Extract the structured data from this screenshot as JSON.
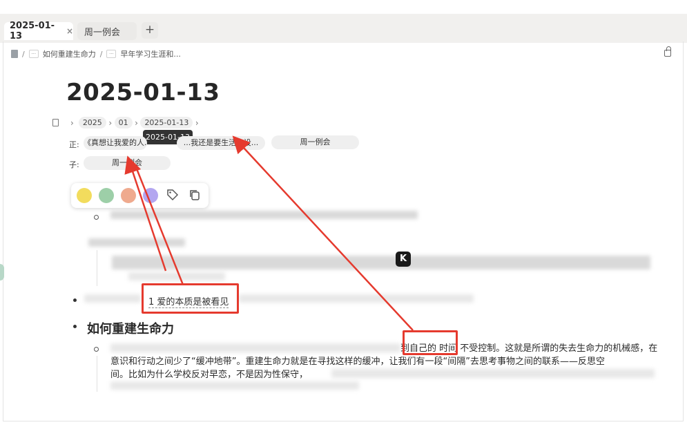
{
  "tabs": [
    {
      "label": "2025-01-13",
      "close": "×",
      "active": true
    },
    {
      "label": "周一例会",
      "active": false
    }
  ],
  "tab_add": "+",
  "breadcrumb": {
    "sep": "/",
    "items": [
      "如何重建生命力",
      "早年学习生涯和..."
    ]
  },
  "page": {
    "title": "2025-01-13",
    "path": [
      "2025",
      "01",
      "2025-01-13"
    ],
    "tooltip": "2025-01-13"
  },
  "relations": {
    "forward_label": "正:",
    "forward_items": [
      "《真想让我爱的人...",
      "...我还是要生活...设...",
      "周一例会"
    ],
    "child_label": "子:",
    "child_items": [
      "周一例会"
    ]
  },
  "toolbar": {
    "colors": [
      "#f2dc5d",
      "#9dcfa8",
      "#efaa8e",
      "#b3a6f0"
    ],
    "icons": [
      "tag-icon",
      "copy-icon"
    ]
  },
  "content": {
    "highlight_text": "1 爱的本质是被看见",
    "heading": "如何重建生命力",
    "para_lines": [
      "到自己的 时间 不受控制。这就是所谓的失去生命力的机械感，在",
      "意识和行动之间少了“缓冲地带”。重建生命力就是在寻找这样的缓冲，让我们有一段“间隔”去思考事物之间的联系——反思空",
      "间。比如为什么学校反对早恋，不是因为性保守，"
    ]
  }
}
